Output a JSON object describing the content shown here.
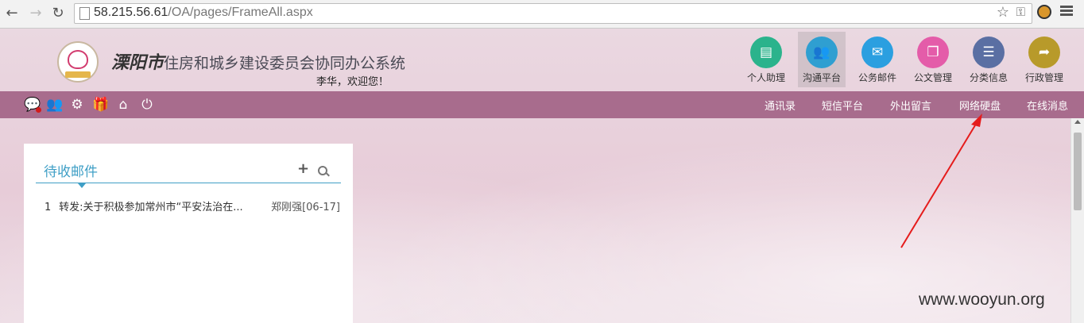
{
  "browser": {
    "url_host": "58.215.56.61",
    "url_path": "/OA/pages/FrameAll.aspx"
  },
  "header": {
    "title_city": "溧阳市",
    "title_rest": "住房和城乡建设委员会协同办公系统",
    "welcome": "李华，欢迎您！"
  },
  "top_nav": [
    {
      "label": "个人助理",
      "icon": "cabinet-icon",
      "color": "#2bb38c"
    },
    {
      "label": "沟通平台",
      "icon": "users-icon",
      "color": "#2f9fd1"
    },
    {
      "label": "公务邮件",
      "icon": "mail-icon",
      "color": "#2b9fe0"
    },
    {
      "label": "公文管理",
      "icon": "documents-icon",
      "color": "#e45ca9"
    },
    {
      "label": "分类信息",
      "icon": "list-icon",
      "color": "#5a6fa3"
    },
    {
      "label": "行政管理",
      "icon": "folder-icon",
      "color": "#b89a2a"
    }
  ],
  "menubar": {
    "links": [
      "通讯录",
      "短信平台",
      "外出留言",
      "网络硬盘",
      "在线消息"
    ]
  },
  "mail_panel": {
    "title": "待收邮件",
    "rows": [
      {
        "index": "1",
        "subject": "转发:关于积极参加常州市“平安法治在...",
        "meta": "郑刚强[06-17]"
      }
    ]
  },
  "watermark": "www.wooyun.org",
  "colors": {
    "menubar": "#a86c8d",
    "accent": "#3f9fc6",
    "annotation": "#e51c1c"
  }
}
